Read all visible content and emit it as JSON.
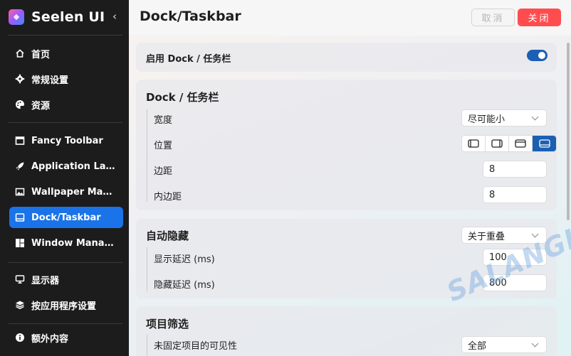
{
  "app": {
    "name": "Seelen UI",
    "collapse_icon": "chevron-left-icon"
  },
  "sidebar": {
    "items": [
      {
        "label": "首页",
        "icon": "home-icon"
      },
      {
        "label": "常规设置",
        "icon": "gear-icon"
      },
      {
        "label": "资源",
        "icon": "palette-icon"
      },
      {
        "label": "Fancy Toolbar",
        "icon": "toolbar-icon"
      },
      {
        "label": "Application Launcher",
        "icon": "rocket-icon"
      },
      {
        "label": "Wallpaper Manager",
        "icon": "wallpaper-icon"
      },
      {
        "label": "Dock/Taskbar",
        "icon": "dock-icon",
        "active": true
      },
      {
        "label": "Window Manager",
        "icon": "window-layout-icon"
      },
      {
        "label": "显示器",
        "icon": "monitor-icon"
      },
      {
        "label": "按应用程序设置",
        "icon": "layers-icon"
      },
      {
        "label": "额外内容",
        "icon": "info-icon"
      }
    ]
  },
  "header": {
    "title": "Dock/Taskbar",
    "cancel_label": "取消",
    "close_label": "关闭"
  },
  "main": {
    "enable": {
      "label": "启用 Dock / 任务栏",
      "enabled": true
    },
    "dock_section": {
      "title": "Dock / 任务栏",
      "width_label": "宽度",
      "width_value": "尽可能小",
      "position_label": "位置",
      "position_options": [
        "left-edge-icon",
        "right-edge-icon",
        "top-edge-icon",
        "bottom-edge-icon"
      ],
      "position_selected": "bottom-edge-icon",
      "margin_label": "边距",
      "margin_value": "8",
      "padding_label": "内边距",
      "padding_value": "8"
    },
    "autohide_section": {
      "title": "自动隐藏",
      "mode_value": "关于重叠",
      "show_delay_label": "显示延迟 (ms)",
      "show_delay_value": "100",
      "hide_delay_label": "隐藏延迟 (ms)",
      "hide_delay_value": "800"
    },
    "filter_section": {
      "title": "项目筛选",
      "unpinned_label": "未固定项目的可见性",
      "unpinned_value": "全部"
    }
  },
  "watermark": "SALANGHE",
  "colors": {
    "accent": "#1a73e8",
    "toggle": "#1a5fb4",
    "danger": "#ff4d4f",
    "sidebar": "#1c1c1c"
  }
}
